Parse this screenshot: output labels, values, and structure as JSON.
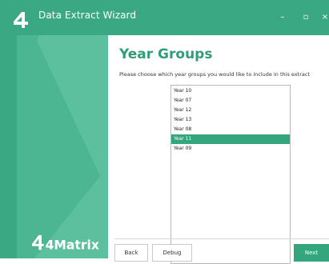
{
  "window": {
    "title": "Data Extract Wizard",
    "controls": {
      "minimize": "–",
      "maximize": "▫",
      "close": "×"
    },
    "accent_color": "#3aa883"
  },
  "sidebar": {
    "brand": "4Matrix",
    "logo_icon": "4matrix-logo-icon"
  },
  "page": {
    "heading": "Year Groups",
    "instruction": "Please choose which year groups you would like to include in this extract"
  },
  "year_list": {
    "items": [
      "Year 10",
      "Year 07",
      "Year 12",
      "Year 13",
      "Year 08",
      "Year 11",
      "Year 09"
    ],
    "selected": "Year 11"
  },
  "buttons": {
    "back": "Back",
    "debug": "Debug",
    "next": "Next"
  }
}
